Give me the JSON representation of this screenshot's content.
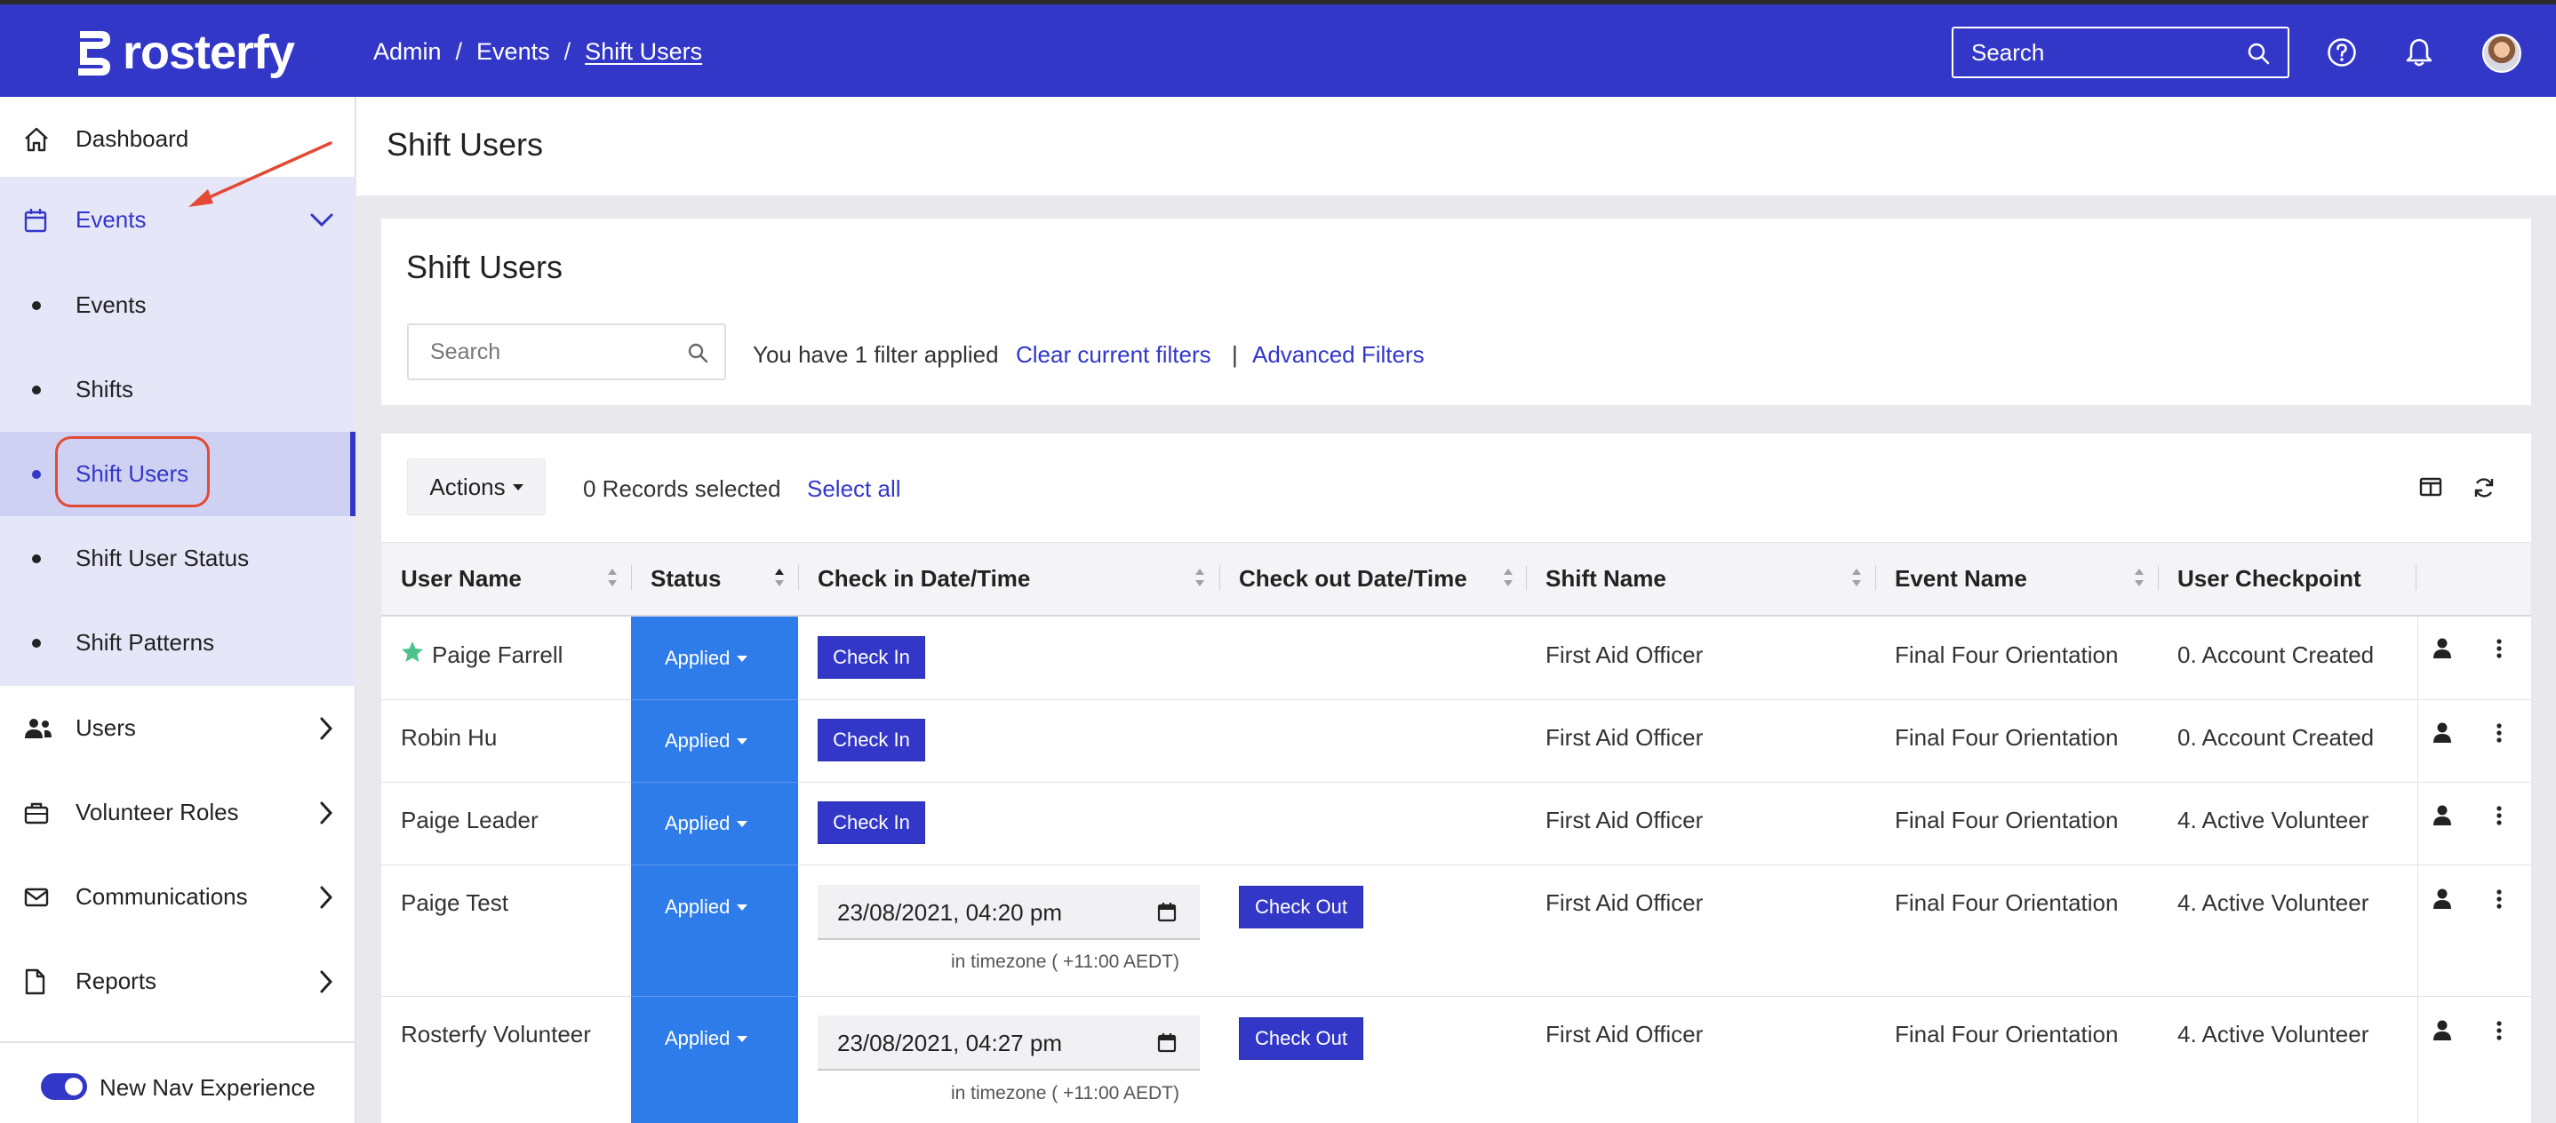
{
  "app": {
    "logo_text": "rosterfy"
  },
  "breadcrumb": {
    "items": [
      "Admin",
      "Events",
      "Shift Users"
    ],
    "separator": "/"
  },
  "top_search": {
    "placeholder": "Search"
  },
  "colors": {
    "primary": "#3237c8",
    "status_blue": "#2e7bea",
    "annotation_red": "#e24a35",
    "sidebar_active_bg": "#e5e6f7"
  },
  "sidebar": {
    "dashboard": "Dashboard",
    "events_group": "Events",
    "sub_items": [
      "Events",
      "Shifts",
      "Shift Users",
      "Shift User Status",
      "Shift Patterns"
    ],
    "selected_sub_item": "Shift Users",
    "users": "Users",
    "volunteer_roles": "Volunteer Roles",
    "communications": "Communications",
    "reports": "Reports",
    "toggle_label": "New Nav Experience",
    "toggle_on": true
  },
  "page": {
    "title": "Shift Users"
  },
  "filter_card": {
    "title": "Shift Users",
    "search_placeholder": "Search",
    "filter_text": "You have 1 filter applied",
    "clear_label": "Clear current filters",
    "separator": "|",
    "advanced_label": "Advanced Filters"
  },
  "table_toolbar": {
    "actions_label": "Actions",
    "records_selected": "0 Records selected",
    "select_all": "Select all"
  },
  "table": {
    "columns": [
      "User Name",
      "Status",
      "Check in Date/Time",
      "Check out Date/Time",
      "Shift Name",
      "Event Name",
      "User Checkpoint"
    ],
    "rows": [
      {
        "user": "Paige Farrell",
        "starred": true,
        "status": "Applied",
        "checkin_button": "Check In",
        "shift": "First Aid Officer",
        "event": "Final Four Orientation",
        "checkpoint": "0. Account Created"
      },
      {
        "user": "Robin Hu",
        "starred": false,
        "status": "Applied",
        "checkin_button": "Check In",
        "shift": "First Aid Officer",
        "event": "Final Four Orientation",
        "checkpoint": "0. Account Created"
      },
      {
        "user": "Paige Leader",
        "starred": false,
        "status": "Applied",
        "checkin_button": "Check In",
        "shift": "First Aid Officer",
        "event": "Final Four Orientation",
        "checkpoint": "4. Active Volunteer"
      },
      {
        "user": "Paige Test",
        "starred": false,
        "status": "Applied",
        "checkin_datetime": "23/08/2021, 04:20 pm",
        "timezone_note": "in timezone ( +11:00 AEDT)",
        "checkout_button": "Check Out",
        "shift": "First Aid Officer",
        "event": "Final Four Orientation",
        "checkpoint": "4. Active Volunteer"
      },
      {
        "user": "Rosterfy Volunteer",
        "starred": false,
        "status": "Applied",
        "checkin_datetime": "23/08/2021, 04:27 pm",
        "timezone_note": "in timezone ( +11:00 AEDT)",
        "checkout_button": "Check Out",
        "shift": "First Aid Officer",
        "event": "Final Four Orientation",
        "checkpoint": "4. Active Volunteer"
      }
    ]
  }
}
